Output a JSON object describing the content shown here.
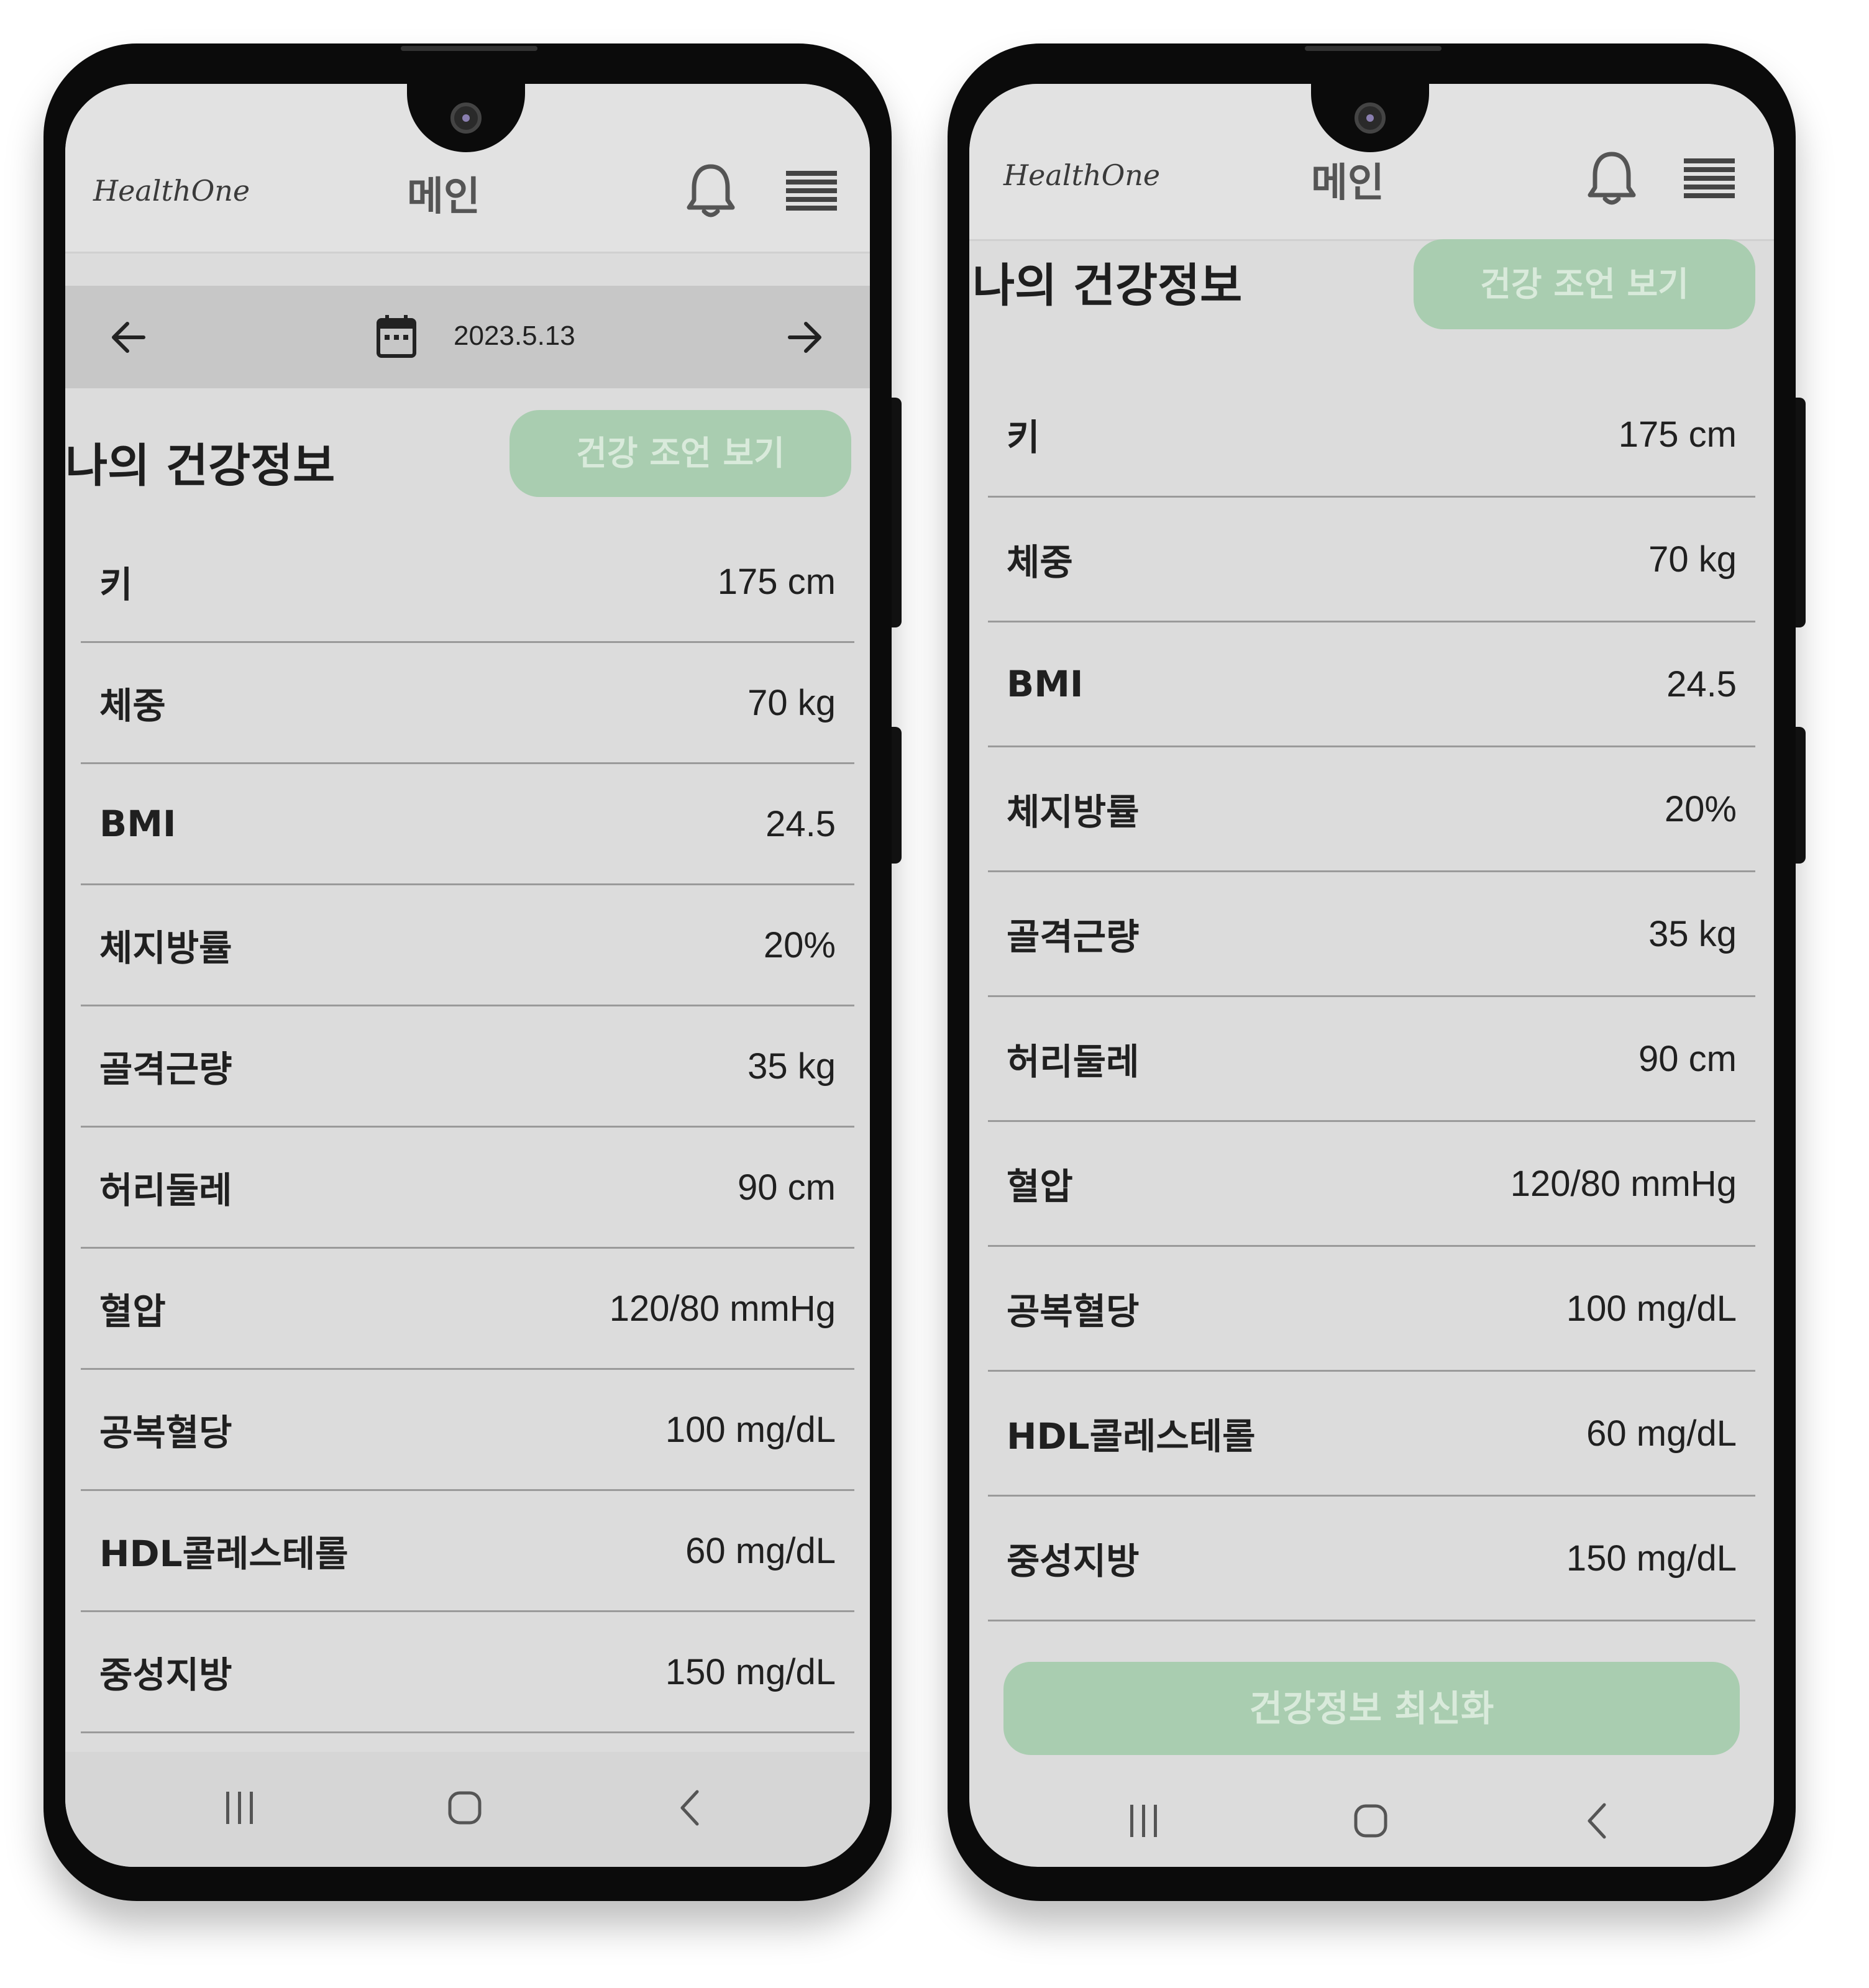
{
  "app": {
    "logo": "HealthOne",
    "title": "메인"
  },
  "date_nav": {
    "date": "2023.5.13"
  },
  "section": {
    "title": "나의 건강정보",
    "advice_button": "건강 조언 보기"
  },
  "health_rows": [
    {
      "label": "키",
      "value": "175 cm"
    },
    {
      "label": "체중",
      "value": "70 kg"
    },
    {
      "label": "BMI",
      "value": "24.5"
    },
    {
      "label": "체지방률",
      "value": "20%"
    },
    {
      "label": "골격근량",
      "value": "35 kg"
    },
    {
      "label": "허리둘레",
      "value": "90 cm"
    },
    {
      "label": "혈압",
      "value": "120/80 mmHg"
    },
    {
      "label": "공복혈당",
      "value": "100 mg/dL"
    },
    {
      "label": "HDL콜레스테롤",
      "value": "60 mg/dL"
    },
    {
      "label": "중성지방",
      "value": "150 mg/dL"
    }
  ],
  "refresh_button": "건강정보 최신화",
  "icons": {
    "notification": "bell-icon",
    "menu": "hamburger-menu-icon",
    "prev": "arrow-left-icon",
    "next": "arrow-right-icon",
    "calendar": "calendar-icon",
    "nav_recents": "recents-icon",
    "nav_home": "home-icon",
    "nav_back": "back-icon"
  },
  "colors": {
    "accent": "#a9cdb0",
    "screen_bg": "#dcdcdc",
    "date_bar": "#c7c7c7"
  }
}
